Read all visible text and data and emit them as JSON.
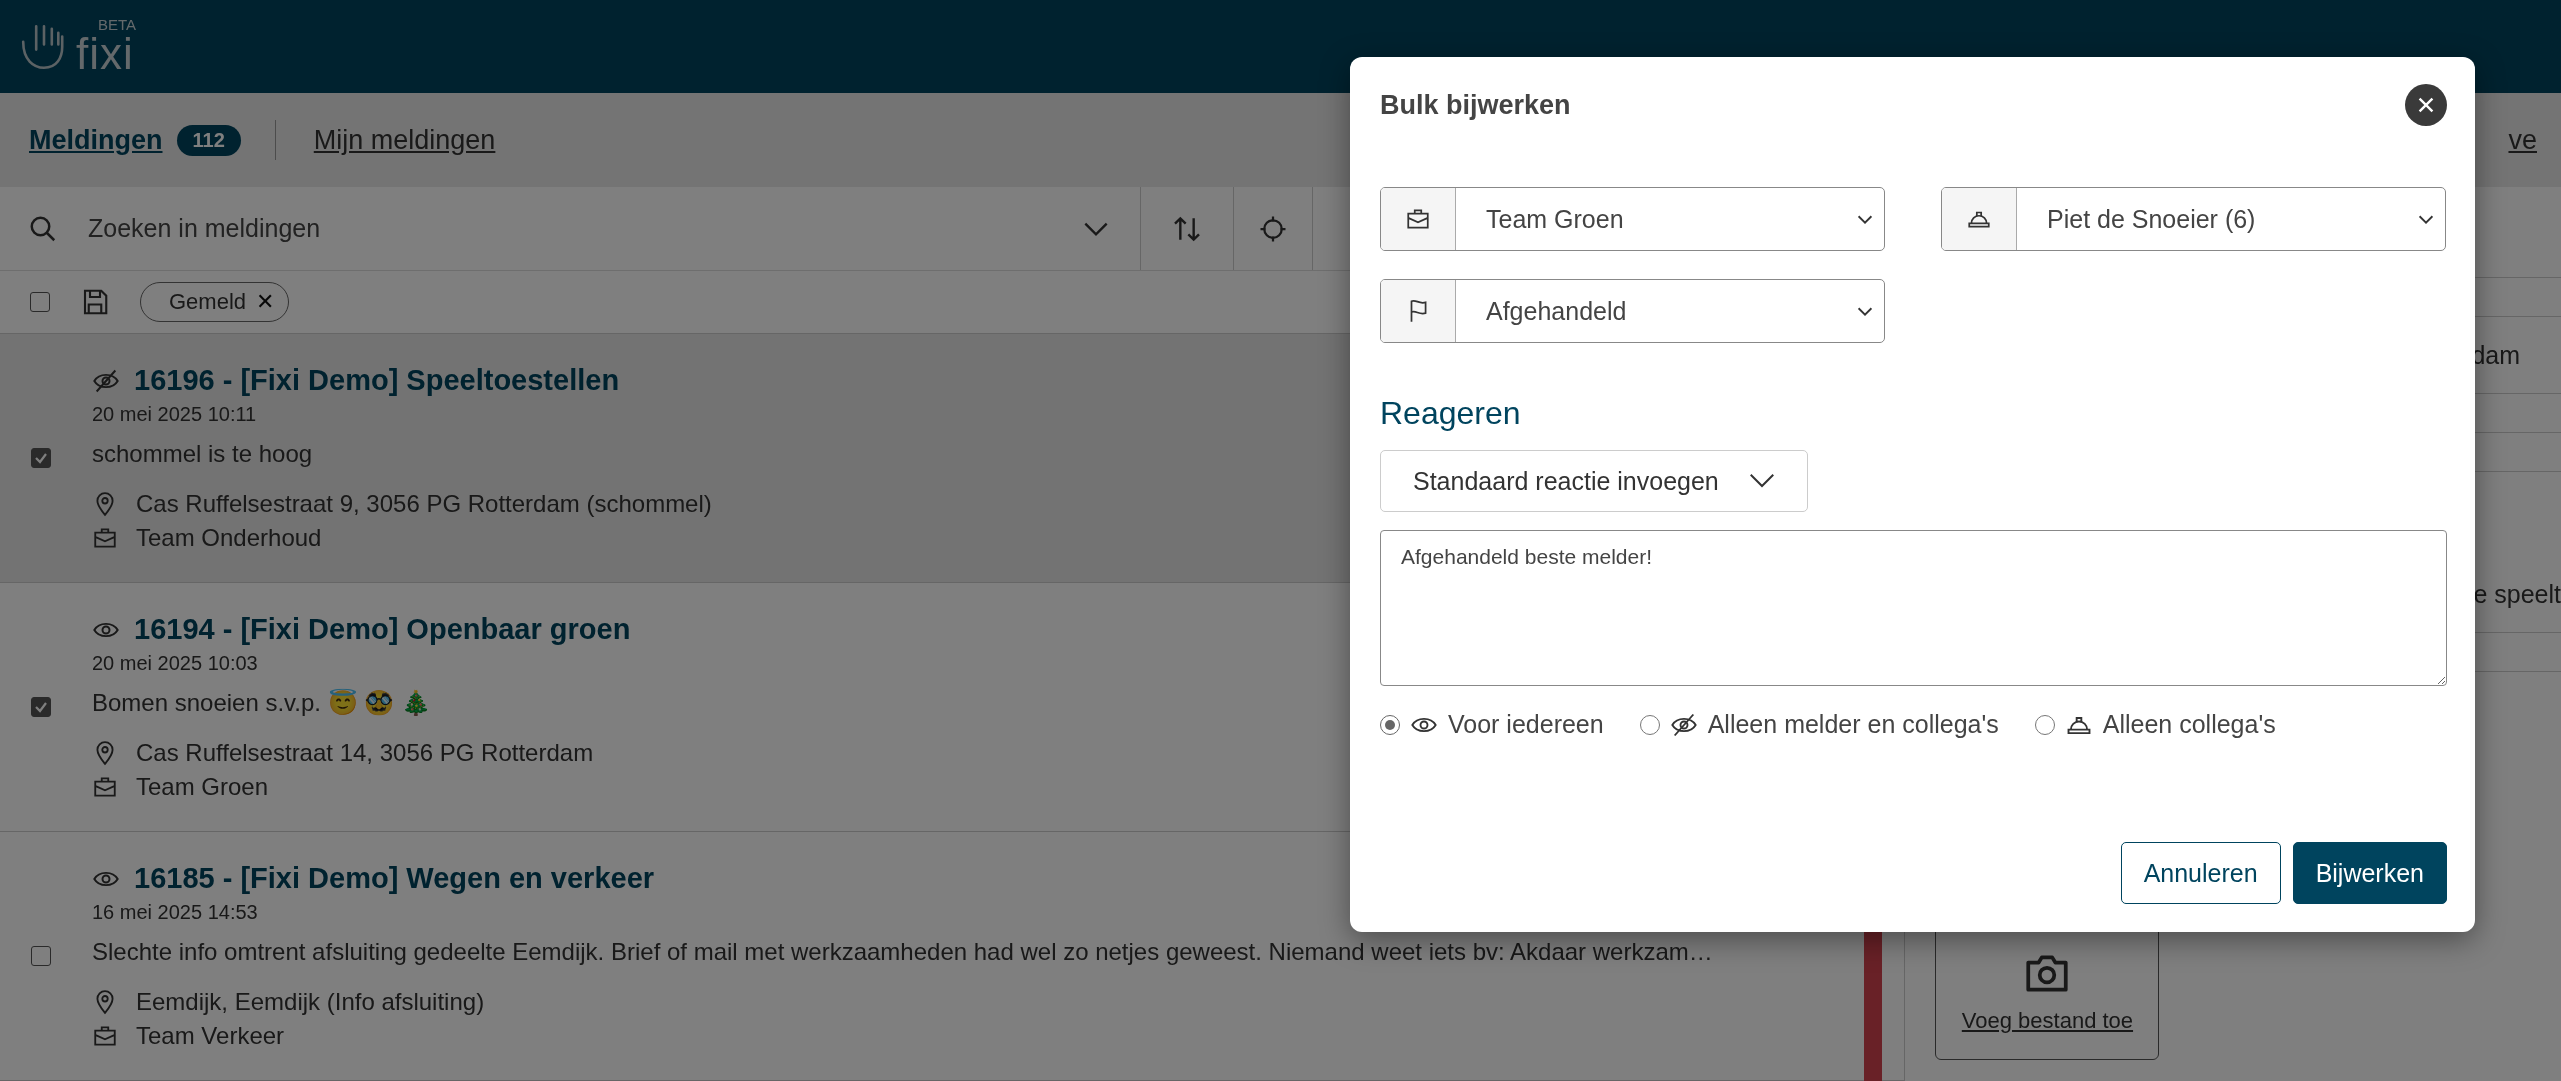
{
  "app": {
    "logo_text": "fixi",
    "logo_badge": "BETA"
  },
  "tabs": [
    {
      "label": "Meldingen",
      "count": "112",
      "selected": true
    },
    {
      "label": "Mijn meldingen",
      "selected": false
    }
  ],
  "header_link_fragment": "ve",
  "search": {
    "placeholder": "Zoeken in meldingen"
  },
  "filters": {
    "select_all_checked": false,
    "chips": [
      {
        "label": "Gemeld",
        "remove": "✕"
      }
    ]
  },
  "reports": [
    {
      "public": false,
      "title": "16196 - [Fixi Demo] Speeltoestellen",
      "date": "20 mei 2025 10:11",
      "description": "schommel is te hoog",
      "location": "Cas Ruffelsestraat 9, 3056 PG Rotterdam (schommel)",
      "team": "Team Onderhoud",
      "checked": true,
      "selected": true,
      "urgent": false
    },
    {
      "public": true,
      "title": "16194 - [Fixi Demo] Openbaar groen",
      "date": "20 mei 2025 10:03",
      "description": "Bomen snoeien s.v.p. 😇 🥸 🎄",
      "location": "Cas Ruffelsestraat 14, 3056 PG Rotterdam",
      "team": "Team Groen",
      "checked": true,
      "selected": false,
      "urgent": false
    },
    {
      "public": true,
      "title": "16185 - [Fixi Demo] Wegen en verkeer",
      "date": "16 mei 2025 14:53",
      "description": "Slechte info omtrent afsluiting gedeelte Eemdijk. Brief of mail met werkzaamheden had wel zo netjes geweest. Niemand weet iets bv: Akdaar werkzam…",
      "location": "Eemdijk, Eemdijk (Info afsluiting)",
      "team": "Team Verkeer",
      "checked": false,
      "selected": false,
      "urgent": true
    }
  ],
  "detail_panel": {
    "row_fragments": [
      "dam",
      "e speelt"
    ],
    "upload_label": "Voeg bestand toe"
  },
  "modal": {
    "title": "Bulk bijwerken",
    "selects": [
      {
        "kind": "team",
        "value": "Team Groen"
      },
      {
        "kind": "person",
        "value": "Piet de Snoeier (6)"
      },
      {
        "kind": "status",
        "value": "Afgehandeld"
      }
    ],
    "section_title": "Reageren",
    "template_select": "Standaard reactie invoegen",
    "reply_text": "Afgehandeld beste melder!",
    "visibility_options": [
      {
        "kind": "public",
        "label": "Voor iedereen",
        "selected": true
      },
      {
        "kind": "hidden",
        "label": "Alleen melder en collega's",
        "selected": false
      },
      {
        "kind": "person",
        "label": "Alleen collega's",
        "selected": false
      }
    ],
    "buttons": [
      {
        "kind": "secondary",
        "label": "Annuleren"
      },
      {
        "kind": "primary",
        "label": "Bijwerken"
      }
    ]
  }
}
